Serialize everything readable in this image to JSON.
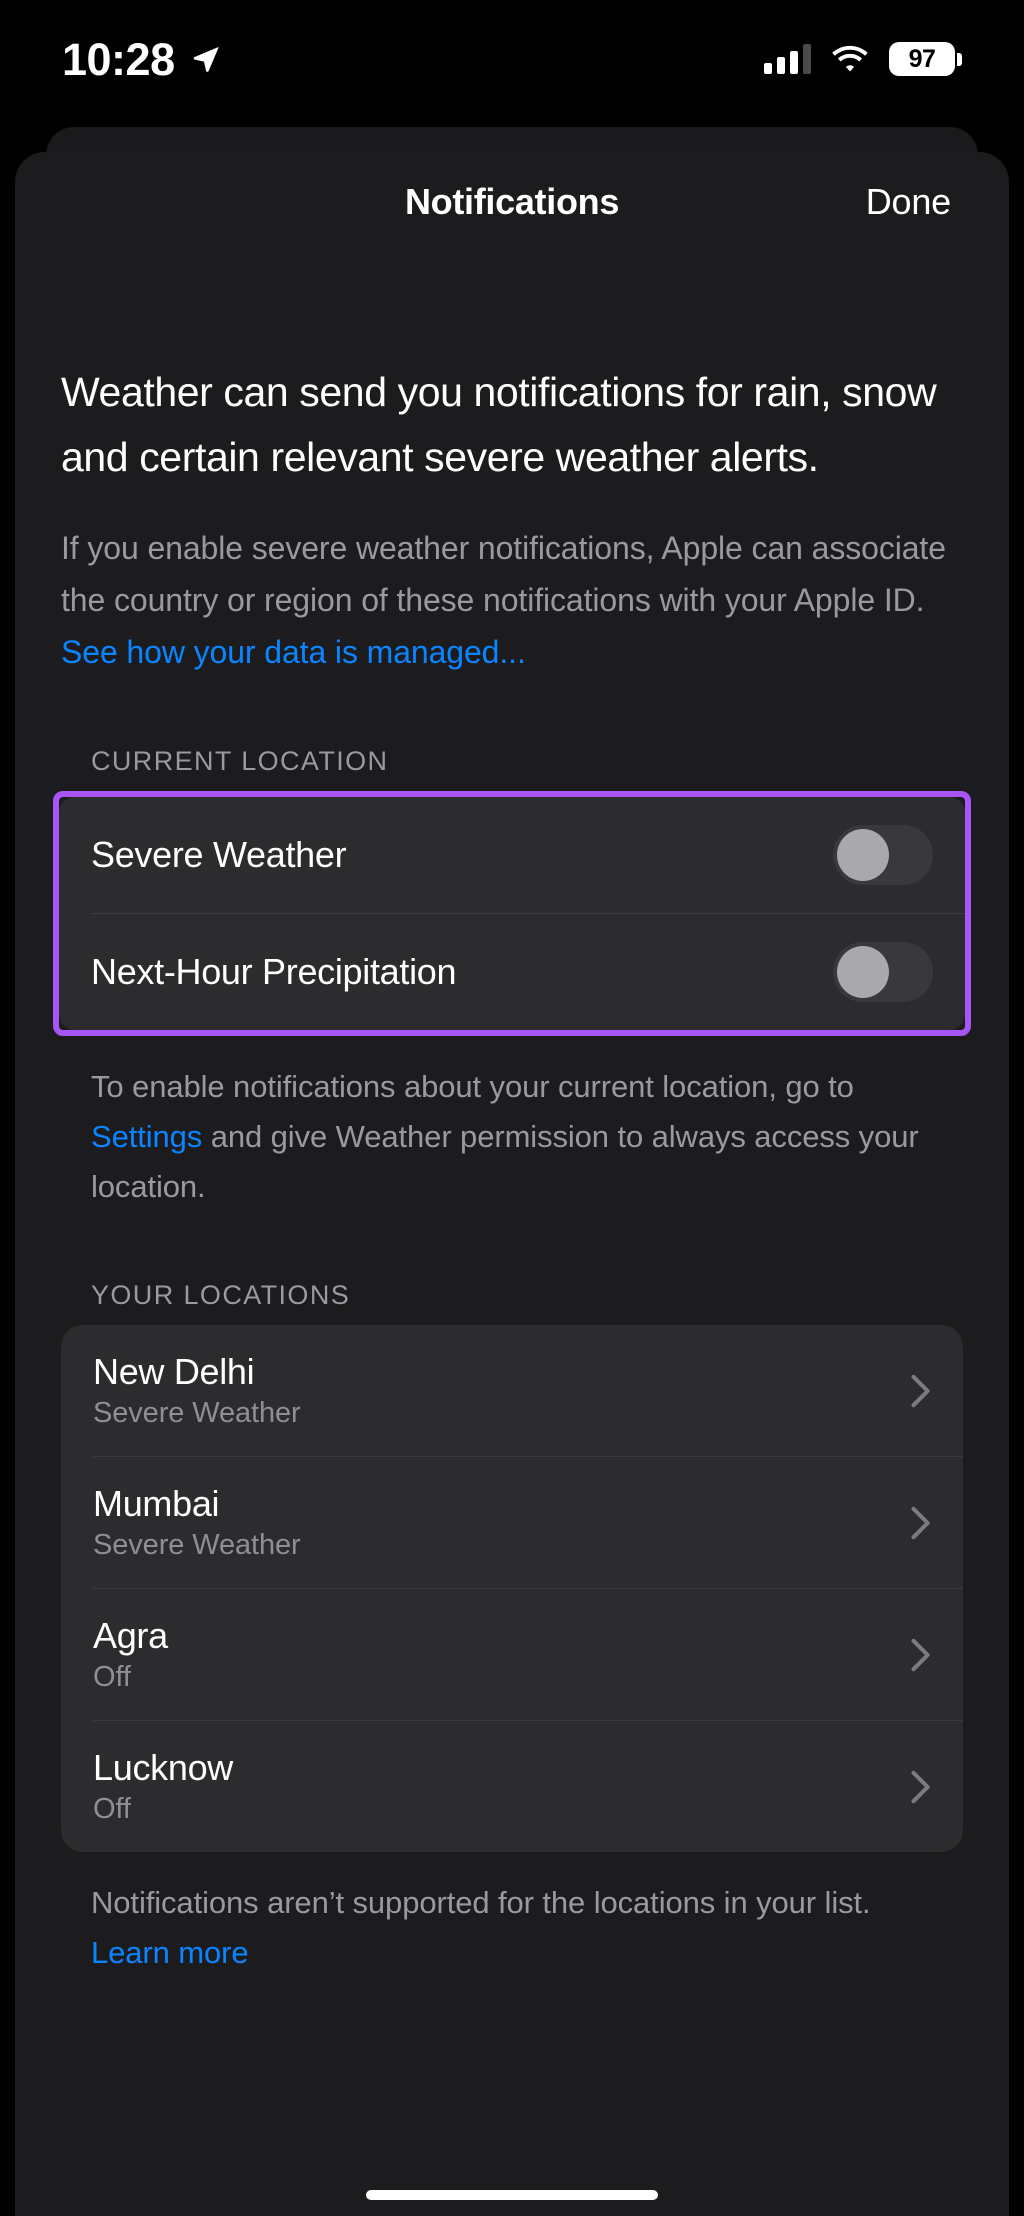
{
  "status_bar": {
    "time": "10:28",
    "location_icon": "location-arrow-icon",
    "signal_icon": "cellular-signal-icon",
    "signal_bars_filled": 3,
    "signal_bars_total": 4,
    "wifi_icon": "wifi-icon",
    "battery_percent": "97",
    "battery_icon": "battery-icon"
  },
  "nav": {
    "title": "Notifications",
    "done_label": "Done"
  },
  "intro": {
    "heading": "Weather can send you notifications for rain, snow and certain relevant severe weather alerts.",
    "body_prefix": "If you enable severe weather notifications, Apple can associate the country or region of these notifications with your Apple ID. ",
    "body_link": "See how your data is managed..."
  },
  "current_location": {
    "section_header": "CURRENT LOCATION",
    "rows": [
      {
        "label": "Severe Weather",
        "toggle_on": false
      },
      {
        "label": "Next-Hour Precipitation",
        "toggle_on": false
      }
    ],
    "footnote_part1": "To enable notifications about your current location, go to ",
    "footnote_link": "Settings",
    "footnote_part2": " and give Weather permission to always access your location."
  },
  "your_locations": {
    "section_header": "YOUR LOCATIONS",
    "rows": [
      {
        "name": "New Delhi",
        "status": "Severe Weather",
        "chevron": "chevron-right-icon"
      },
      {
        "name": "Mumbai",
        "status": "Severe Weather",
        "chevron": "chevron-right-icon"
      },
      {
        "name": "Agra",
        "status": "Off",
        "chevron": "chevron-right-icon"
      },
      {
        "name": "Lucknow",
        "status": "Off",
        "chevron": "chevron-right-icon"
      }
    ],
    "footnote_part1": "Notifications aren’t supported for the locations in your list. ",
    "footnote_link": "Learn more"
  },
  "colors": {
    "accent_link": "#0a84ff",
    "annotation_highlight": "#a855f7",
    "sheet_background": "#1c1c1e",
    "card_background": "#2c2c2e",
    "secondary_text": "#9a9a9e"
  }
}
